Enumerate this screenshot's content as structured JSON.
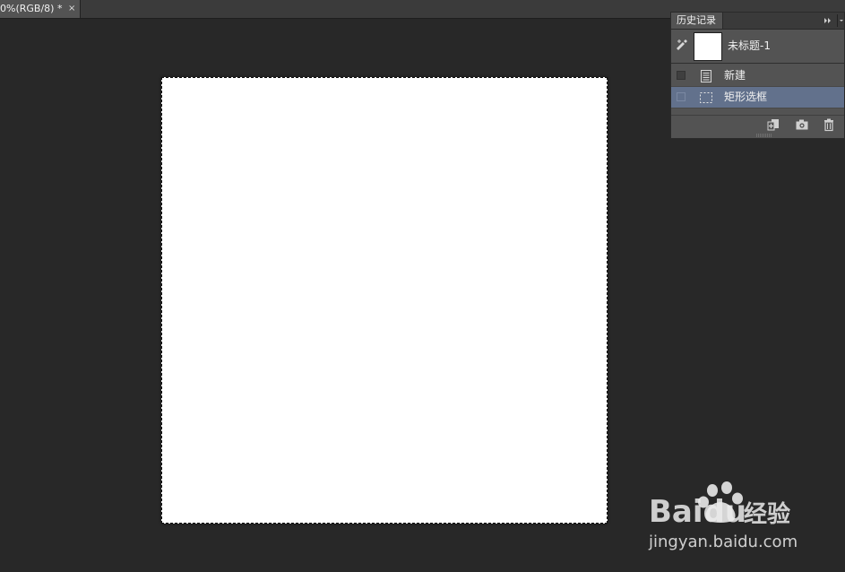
{
  "document_tab": {
    "title": "0%(RGB/8) *",
    "close_glyph": "×"
  },
  "history_panel": {
    "tab_label": "历史记录",
    "snapshot": {
      "label": "未标题-1"
    },
    "items": [
      {
        "label": "新建",
        "icon": "new-document-icon",
        "selected": false
      },
      {
        "label": "矩形选框",
        "icon": "rectangular-marquee-icon",
        "selected": true
      }
    ],
    "footer_icons": [
      "new-document-from-state-icon",
      "camera-icon",
      "trash-icon"
    ]
  },
  "watermark": {
    "brand": "Baidu",
    "brand_suffix": "经验",
    "url": "jingyan.baidu.com"
  },
  "colors": {
    "workspace": "#282828",
    "panel": "#535353",
    "selection": "#62718c",
    "canvas": "#ffffff"
  }
}
